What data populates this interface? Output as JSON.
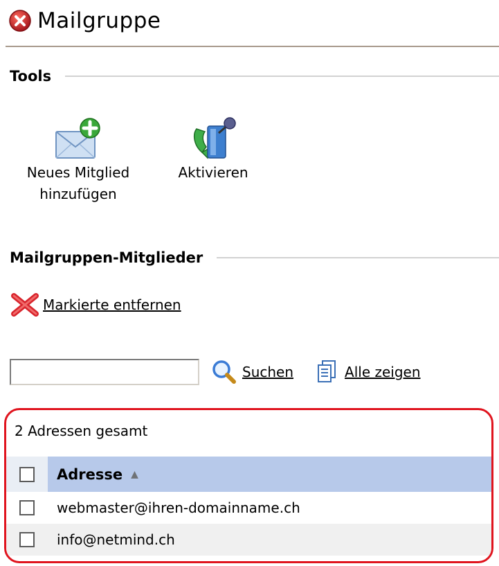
{
  "header": {
    "title": "Mailgruppe"
  },
  "tools": {
    "heading": "Tools",
    "items": [
      {
        "label_line1": "Neues Mitglied",
        "label_line2": "hinzufügen",
        "icon": "mail-add-icon"
      },
      {
        "label": "Aktivieren",
        "icon": "activate-icon"
      }
    ]
  },
  "members": {
    "heading": "Mailgruppen-Mitglieder",
    "remove_label": "Markierte entfernen"
  },
  "search": {
    "value": "",
    "search_label": "Suchen",
    "show_all_label": "Alle zeigen"
  },
  "results": {
    "count_text": "2 Adressen gesamt",
    "column_header": "Adresse",
    "sort_indicator": "▲",
    "rows": [
      {
        "address": "webmaster@ihren-domainname.ch"
      },
      {
        "address": "info@netmind.ch"
      }
    ]
  },
  "colors": {
    "highlight_border": "#e0141e",
    "header_bg": "#b7c9ea",
    "title_icon": "#c0262d"
  }
}
